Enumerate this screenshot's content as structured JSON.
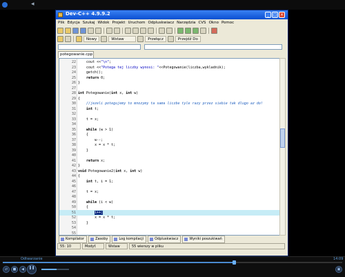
{
  "window": {
    "title": "Dev-C++ 4.9.9.2"
  },
  "menu": [
    "Plik",
    "Edycja",
    "Szukaj",
    "Widok",
    "Projekt",
    "Uruchom",
    "Odpluskwiacz",
    "Narzędzia",
    "CVS",
    "Okno",
    "Pomoc"
  ],
  "toolbar": {
    "new_label": "Nowy",
    "insert_label": "Wstaw",
    "toggle_label": "Przełącz",
    "goto_label": "Przejdź Do"
  },
  "file_tab": "potegowanie.cpp",
  "code_lines": [
    {
      "n": "22",
      "t": "    cout <<\"\\n\";"
    },
    {
      "n": "23",
      "t": "    cout <<\"Potega tej liczby wynosi: \"<<Potegowanie(liczba,wykladnik);"
    },
    {
      "n": "24",
      "t": "    getch();"
    },
    {
      "n": "25",
      "t": "    return 0;"
    },
    {
      "n": "26",
      "t": "}"
    },
    {
      "n": "27",
      "t": ""
    },
    {
      "n": "28",
      "t": "int Potegowanie(int x, int w)"
    },
    {
      "n": "29",
      "t": "{"
    },
    {
      "n": "30",
      "t": "    //jezeli potegujemy to mnozymy ta sama liczbe tyle razy przez siebie tak dlugo az do!"
    },
    {
      "n": "31",
      "t": "    int t;"
    },
    {
      "n": "32",
      "t": ""
    },
    {
      "n": "33",
      "t": "    t = x;"
    },
    {
      "n": "34",
      "t": ""
    },
    {
      "n": "35",
      "t": "    while (w > 1)"
    },
    {
      "n": "36",
      "t": "    {"
    },
    {
      "n": "37",
      "t": "        w--;"
    },
    {
      "n": "38",
      "t": "        x = x * t;"
    },
    {
      "n": "39",
      "t": "    }"
    },
    {
      "n": "40",
      "t": ""
    },
    {
      "n": "41",
      "t": "    return x;"
    },
    {
      "n": "42",
      "t": "}"
    },
    {
      "n": "43",
      "t": "void Potegowanie2(int x, int w)"
    },
    {
      "n": "44",
      "t": "{"
    },
    {
      "n": "45",
      "t": "    int t, i = 1;"
    },
    {
      "n": "46",
      "t": ""
    },
    {
      "n": "47",
      "t": "    t = x;"
    },
    {
      "n": "48",
      "t": ""
    },
    {
      "n": "49",
      "t": "    while (i < w)"
    },
    {
      "n": "50",
      "t": "    {"
    },
    {
      "n": "51",
      "t": "        i++;"
    },
    {
      "n": "52",
      "t": "        x = x * t;"
    },
    {
      "n": "53",
      "t": "    }"
    },
    {
      "n": "54",
      "t": ""
    },
    {
      "n": "55",
      "t": ""
    }
  ],
  "bottom_tabs": [
    "Kompilator",
    "Zasoby",
    "Log kompilacji",
    "Odpluskwiacz",
    "Wyniki poszukiwań"
  ],
  "status": {
    "position": "55: 10",
    "modified": "Modyf.",
    "mode": "Wstaw",
    "lines": "55 wierszy w pliku"
  },
  "player": {
    "status_text": "Odtwarzanie",
    "time": "14:09",
    "progress": 0.68,
    "volume": 0.55
  },
  "colors": {
    "titlebar": "#0a4fd1",
    "current_line": "#c6ecf6",
    "selection": "#0a2a80"
  }
}
